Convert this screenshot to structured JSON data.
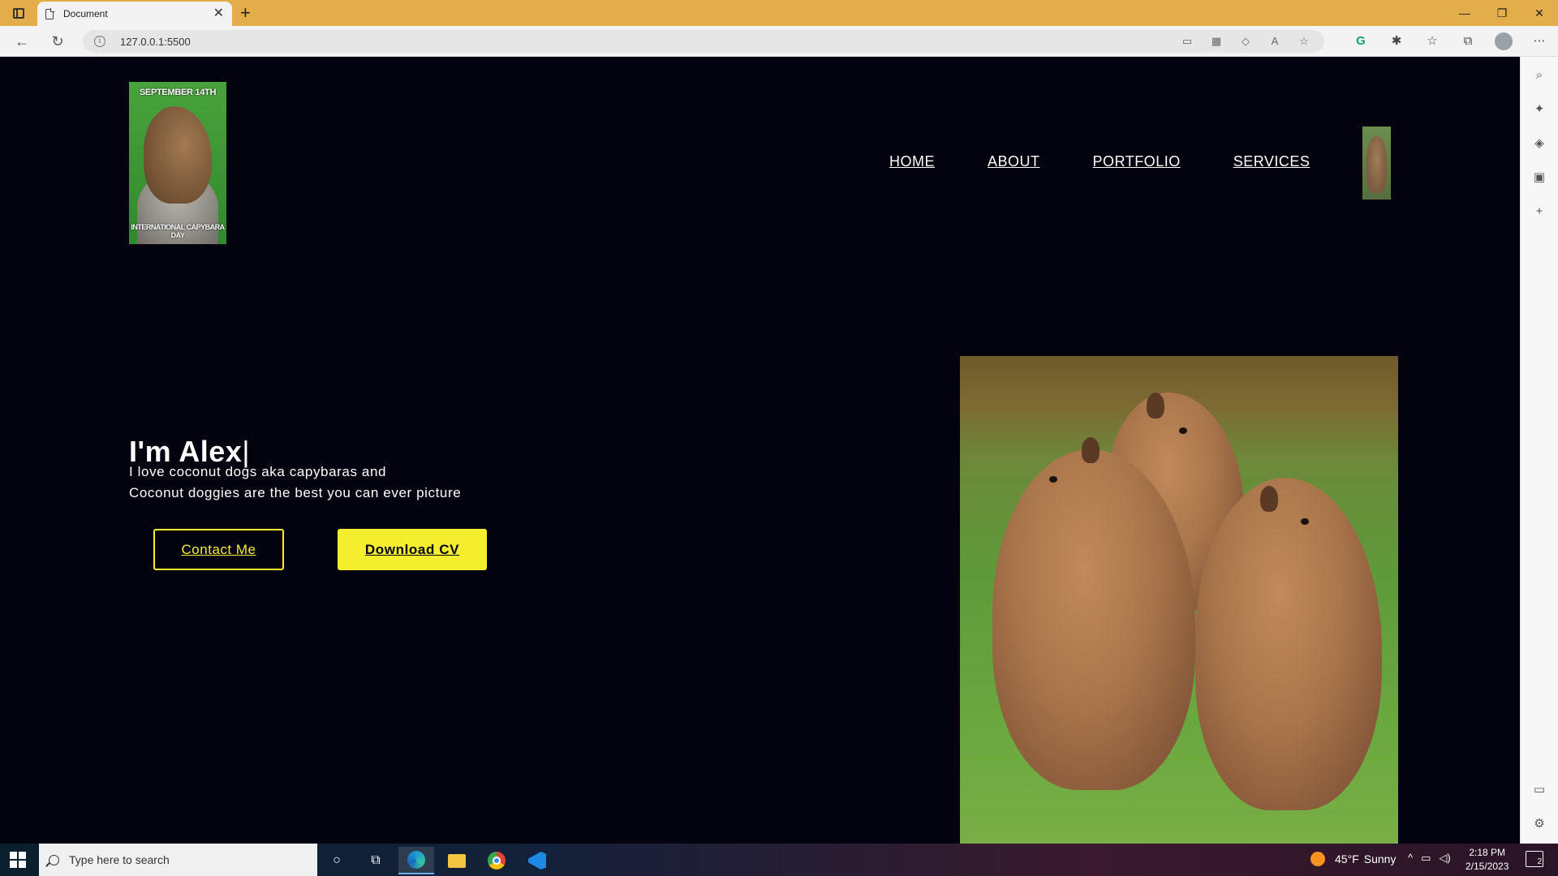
{
  "browser": {
    "tab_title": "Document",
    "url": "127.0.0.1:5500",
    "new_tab_label": "+",
    "tab_close_label": "✕"
  },
  "logo": {
    "top_text": "SEPTEMBER 14TH",
    "bottom_text": "INTERNATIONAL CAPYBARA DAY"
  },
  "nav": {
    "items": [
      {
        "label": "HOME"
      },
      {
        "label": "ABOUT"
      },
      {
        "label": "PORTFOLIO"
      },
      {
        "label": "SERVICES"
      }
    ]
  },
  "hero": {
    "title": "I'm Alex",
    "cursor": "|",
    "line1": "I love coconut dogs aka capybaras and",
    "line2": "Coconut doggies are the best you can ever picture",
    "contact_label": "Contact Me",
    "download_label": "Download CV",
    "accent_color": "#f5ee2f",
    "background_color": "#02030f"
  },
  "taskbar": {
    "search_placeholder": "Type here to search",
    "temperature": "45°F",
    "weather": "Sunny",
    "time": "2:18 PM",
    "date": "2/15/2023",
    "notifications": "2"
  }
}
